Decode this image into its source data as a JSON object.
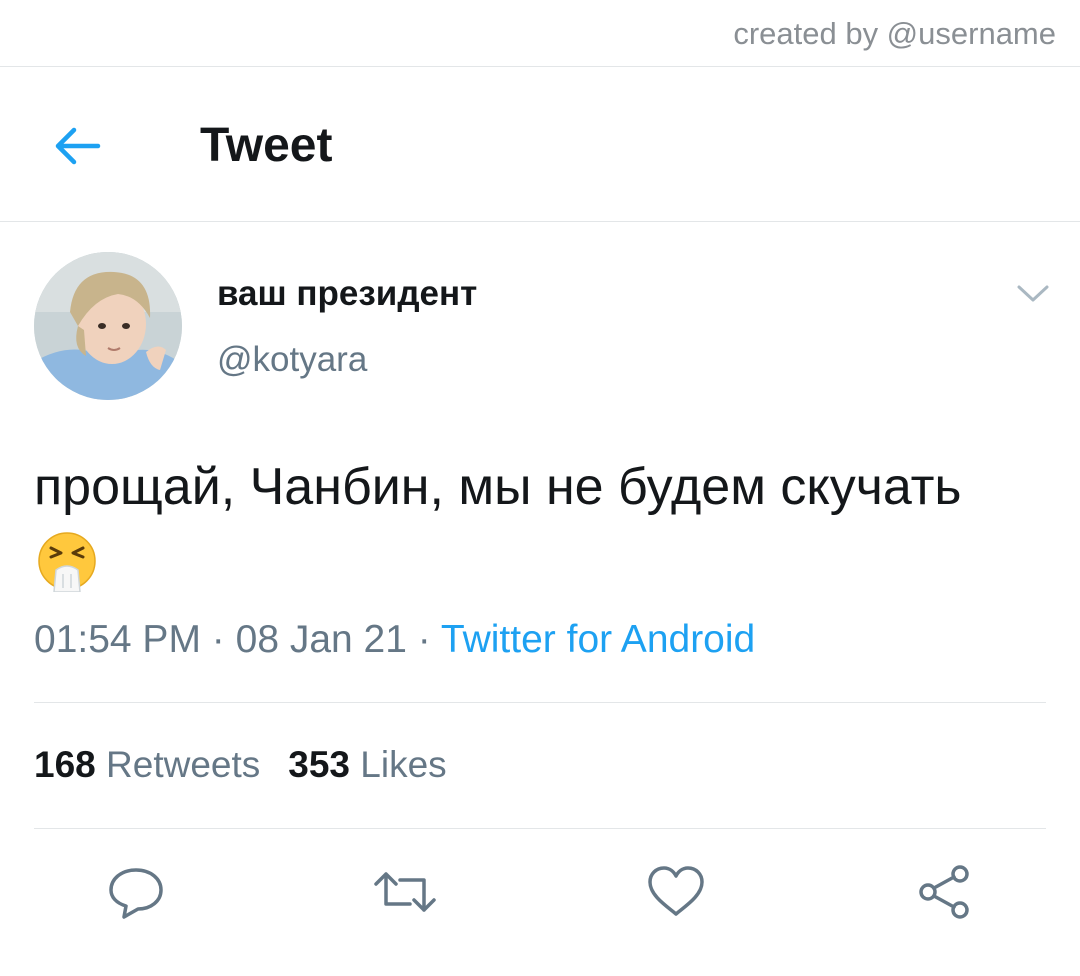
{
  "watermark": "created by @username",
  "header": {
    "title": "Tweet"
  },
  "tweet": {
    "display_name": "ваш президент",
    "handle": "@kotyara",
    "text": "прощай, Чанбин, мы не будем скучать",
    "time": "01:54 PM",
    "date": "08 Jan 21",
    "separator": "·",
    "source": "Twitter for Android",
    "retweets_count": "168",
    "retweets_label": "Retweets",
    "likes_count": "353",
    "likes_label": "Likes"
  },
  "colors": {
    "accent": "#1da1f2",
    "secondary_text": "#657786",
    "primary_text": "#14171a",
    "divider": "#e3e6e8"
  },
  "icons": {
    "back": "arrow-left-icon",
    "menu": "chevron-down-icon",
    "emoji": "sneezing-face-emoji",
    "reply": "reply-icon",
    "retweet": "retweet-icon",
    "like": "heart-icon",
    "share": "share-icon"
  }
}
